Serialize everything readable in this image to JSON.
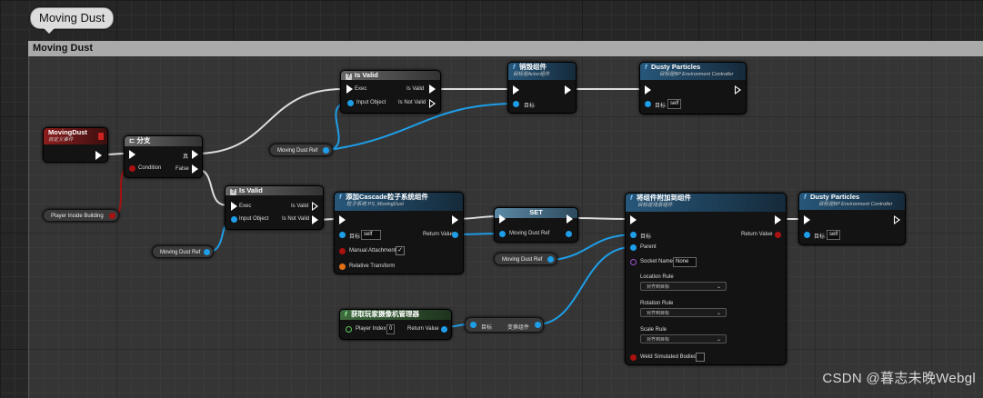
{
  "bubble": {
    "text": "Moving Dust"
  },
  "comment": {
    "title": "Moving Dust"
  },
  "nodes": {
    "moving_dust_event": {
      "title": "MovingDust",
      "subtitle": "自定义事件"
    },
    "branch": {
      "title": "分支",
      "true_label": "真",
      "condition_label": "Condition",
      "false_label": "False"
    },
    "is_valid_1": {
      "title": "Is Valid",
      "exec_label": "Exec",
      "is_valid_label": "Is Valid",
      "input_label": "Input Object",
      "not_valid_label": "Is Not Valid"
    },
    "destroy_component": {
      "title": "销毁组件",
      "subtitle": "目标是Actor组件",
      "target_label": "目标"
    },
    "dusty_particles_1": {
      "title": "Dusty Particles",
      "subtitle": "目标是BP Environment Controller",
      "target_label": "目标",
      "target_value": "self"
    },
    "is_valid_2": {
      "title": "Is Valid",
      "exec_label": "Exec",
      "is_valid_label": "Is Valid",
      "input_label": "Input Object",
      "not_valid_label": "Is Not Valid"
    },
    "add_cascade": {
      "title": "添加Cascade粒子系统组件",
      "subtitle": "粒子系统 PS_MovingDust",
      "target_label": "目标",
      "target_value": "self",
      "return_label": "Return Value",
      "manual_label": "Manual Attachment",
      "manual_checked": "✓",
      "relative_label": "Relative Transform"
    },
    "set_node": {
      "title": "SET",
      "var_label": "Moving Dust Ref"
    },
    "attach_component": {
      "title": "将组件附加到组件",
      "subtitle": "目标是场景组件",
      "target_label": "目标",
      "return_label": "Return Value",
      "parent_label": "Parent",
      "socket_label": "Socket Name",
      "socket_value": "None",
      "location_label": "Location Rule",
      "location_value": "对齐到目标",
      "rotation_label": "Rotation Rule",
      "rotation_value": "对齐到目标",
      "scale_label": "Scale Rule",
      "scale_value": "对齐到目标",
      "weld_label": "Weld Simulated Bodies"
    },
    "dusty_particles_2": {
      "title": "Dusty Particles",
      "subtitle": "目标是BP Environment Controller",
      "target_label": "目标",
      "target_value": "self"
    },
    "get_camera_manager": {
      "title": "获取玩家摄像机管理器",
      "player_index_label": "Player Index",
      "player_index_value": "0",
      "return_label": "Return Value"
    },
    "transform_node": {
      "target_label": "目标",
      "transform_label": "变换组件"
    }
  },
  "vars": {
    "moving_dust_ref_1": "Moving Dust Ref",
    "player_inside_building": "Player Inside Building",
    "moving_dust_ref_2": "Moving Dust Ref",
    "moving_dust_ref_3": "Moving Dust Ref"
  },
  "colors": {
    "exec_wire": "#dddddd",
    "object_wire": "#1e9ee8",
    "bool_wire": "#a11111",
    "header_blue": "#27577a",
    "header_red": "#8c1c1c"
  },
  "watermark": "CSDN @暮志未晚Webgl"
}
